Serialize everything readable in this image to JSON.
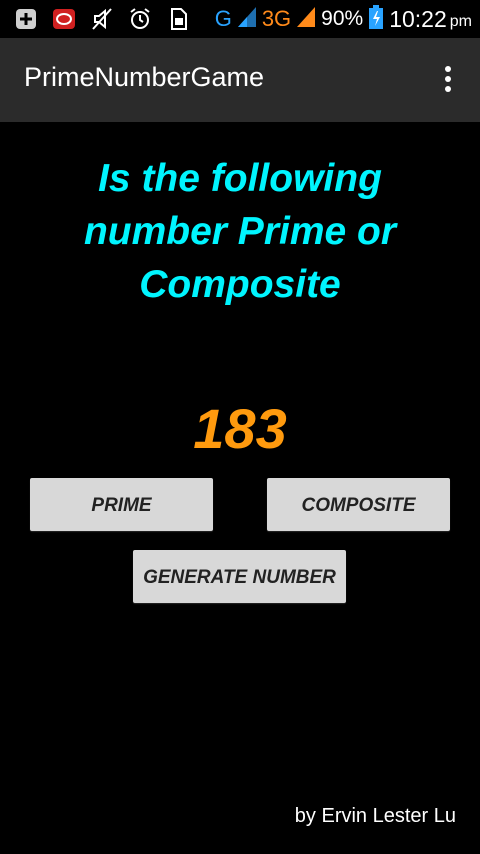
{
  "status_bar": {
    "network_g": "G",
    "network_3g": "3G",
    "battery": "90%",
    "time": "10:22",
    "ampm": "pm"
  },
  "app_bar": {
    "title": "PrimeNumberGame"
  },
  "game": {
    "question": "Is the following number Prime or Composite",
    "number": "183",
    "prime_button": "PRIME",
    "composite_button": "COMPOSITE",
    "generate_button": "GENERATE NUMBER"
  },
  "footer": {
    "credit": "by Ervin Lester Lu"
  },
  "colors": {
    "question": "#00f5ff",
    "number": "#ff9a0e",
    "app_bar": "#2b2b2b"
  }
}
